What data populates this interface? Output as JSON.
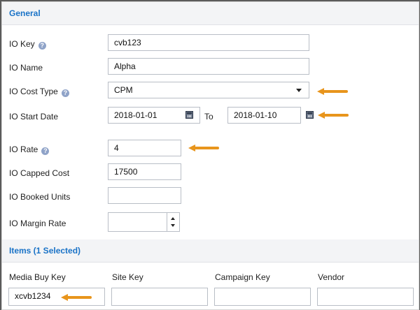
{
  "general": {
    "title": "General",
    "help_glyph": "?",
    "fields": {
      "io_key": {
        "label": "IO Key",
        "value": "cvb123",
        "has_help": true
      },
      "io_name": {
        "label": "IO Name",
        "value": "Alpha"
      },
      "io_cost_type": {
        "label": "IO Cost Type",
        "value": "CPM",
        "has_help": true
      },
      "io_start_date": {
        "label": "IO Start Date",
        "start": "2018-01-01",
        "to_label": "To",
        "end": "2018-01-10"
      },
      "io_rate": {
        "label": "IO Rate",
        "value": "4",
        "has_help": true
      },
      "io_capped_cost": {
        "label": "IO Capped Cost",
        "value": "17500"
      },
      "io_booked_units": {
        "label": "IO Booked Units",
        "value": ""
      },
      "io_margin_rate": {
        "label": "IO Margin Rate",
        "value": ""
      }
    }
  },
  "items": {
    "title": "Items (1 Selected)",
    "columns": [
      "Media Buy Key",
      "Site Key",
      "Campaign Key",
      "Vendor"
    ],
    "values": [
      "xcvb1234",
      "",
      "",
      ""
    ]
  },
  "annotation_color": "#e8951c",
  "icons": {
    "help": "help-icon",
    "calendar": "calendar-icon",
    "dropdown": "chevron-down-icon",
    "annotation": "arrow-left-icon"
  }
}
